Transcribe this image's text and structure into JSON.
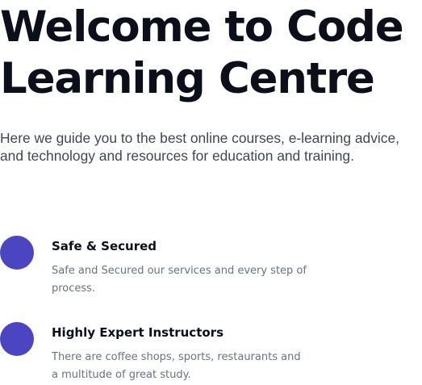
{
  "hero": {
    "title_line1": "Welcome to Code",
    "title_line2": "Learning Centre",
    "description": "Here we guide you to the best online courses, e-learning advice, and technology and resources for education and training."
  },
  "features": [
    {
      "title": "Safe & Secured",
      "description": "Safe and Secured our services and every step of process."
    },
    {
      "title": "Highly Expert Instructors",
      "description": "There are coffee shops, sports, restaurants and a multitude of great study."
    }
  ],
  "colors": {
    "accent": "#4b45c2",
    "heading": "#0b0f1a",
    "body_text": "#3f4654",
    "muted_text": "#6b7280"
  }
}
